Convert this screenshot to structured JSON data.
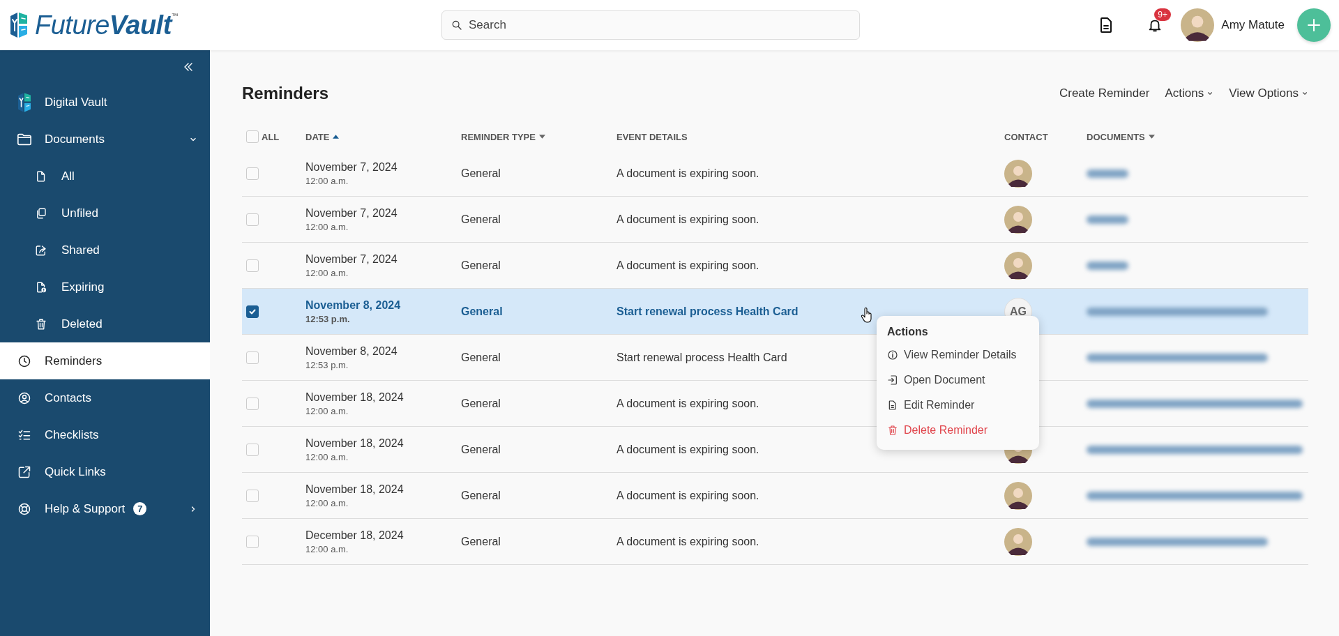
{
  "header": {
    "brand": "Future**Vault**$^{™}$",
    "search": {
      "placeholder": "Search"
    },
    "notifications": {
      "badge": "9+"
    },
    "user": {
      "name": "Amy Matute"
    }
  },
  "sidebar": {
    "items": [
      {
        "label": "Digital Vault",
        "selected": false
      },
      {
        "label": "Documents",
        "selected": false,
        "expanded": true,
        "children": [
          {
            "label": "All",
            "selected": false
          },
          {
            "label": "Unfiled",
            "selected": false
          },
          {
            "label": "Shared",
            "selected": false
          },
          {
            "label": "Expiring",
            "selected": false
          },
          {
            "label": "Deleted",
            "selected": false
          }
        ]
      },
      {
        "label": "Reminders",
        "selected": true
      },
      {
        "label": "Contacts",
        "selected": false
      },
      {
        "label": "Checklists",
        "selected": false
      },
      {
        "label": "Quick Links",
        "selected": false
      },
      {
        "label": "Help & Support",
        "selected": false,
        "badge": "7",
        "expanded": false
      }
    ]
  },
  "page": {
    "title": "Reminders",
    "toolbar": [
      {
        "label": "Create Reminder",
        "dropdown": false
      },
      {
        "label": "Actions",
        "dropdown": true
      },
      {
        "label": "View Options",
        "dropdown": true
      }
    ]
  },
  "table": {
    "select_all": {
      "label": "ALL",
      "checked": false
    },
    "columns": [
      {
        "label": "DATE",
        "sorted": true,
        "dropdown": false
      },
      {
        "label": "REMINDER TYPE",
        "sorted": false,
        "dropdown": true
      },
      {
        "label": "EVENT DETAILS",
        "sorted": false,
        "dropdown": false
      },
      {
        "label": "CONTACT",
        "sorted": false,
        "dropdown": false
      },
      {
        "label": "DOCUMENTS",
        "sorted": false,
        "dropdown": true
      }
    ],
    "rows": [
      {
        "selected": false,
        "date": "November 7, 2024",
        "time": "12:00 a.m.",
        "type": "General",
        "event": "A document is expiring soon.",
        "contact": {
          "kind": "photo"
        },
        "document": {
          "kind": "short"
        }
      },
      {
        "selected": false,
        "date": "November 7, 2024",
        "time": "12:00 a.m.",
        "type": "General",
        "event": "A document is expiring soon.",
        "contact": {
          "kind": "photo"
        },
        "document": {
          "kind": "short"
        }
      },
      {
        "selected": false,
        "date": "November 7, 2024",
        "time": "12:00 a.m.",
        "type": "General",
        "event": "A document is expiring soon.",
        "contact": {
          "kind": "photo"
        },
        "document": {
          "kind": "short"
        }
      },
      {
        "selected": true,
        "date": "November 8, 2024",
        "time": "12:53 p.m.",
        "type": "General",
        "event": "Start renewal process Health Card",
        "contact": {
          "kind": "initials",
          "initials": "AG"
        },
        "document": {
          "kind": "medium"
        }
      },
      {
        "selected": false,
        "date": "November 8, 2024",
        "time": "12:53 p.m.",
        "type": "General",
        "event": "Start renewal process Health Card",
        "document": {
          "kind": "medium"
        }
      },
      {
        "selected": false,
        "date": "November 18, 2024",
        "time": "12:00 a.m.",
        "type": "General",
        "event": "A document is expiring soon.",
        "document": {
          "kind": "long"
        }
      },
      {
        "selected": false,
        "date": "November 18, 2024",
        "time": "12:00 a.m.",
        "type": "General",
        "event": "A document is expiring soon.",
        "contact": {
          "kind": "photo"
        },
        "document": {
          "kind": "long"
        }
      },
      {
        "selected": false,
        "date": "November 18, 2024",
        "time": "12:00 a.m.",
        "type": "General",
        "event": "A document is expiring soon.",
        "contact": {
          "kind": "photo"
        },
        "document": {
          "kind": "long"
        }
      },
      {
        "selected": false,
        "date": "December 18, 2024",
        "time": "12:00 a.m.",
        "type": "General",
        "event": "A document is expiring soon.",
        "contact": {
          "kind": "photo"
        },
        "document": {
          "kind": "medium"
        }
      }
    ]
  },
  "context_menu": {
    "title": "Actions",
    "items": [
      {
        "label": "View Reminder Details",
        "kind": "normal"
      },
      {
        "label": "Open Document",
        "kind": "normal"
      },
      {
        "label": "Edit Reminder",
        "kind": "normal"
      },
      {
        "label": "Delete Reminder",
        "kind": "danger"
      }
    ]
  }
}
